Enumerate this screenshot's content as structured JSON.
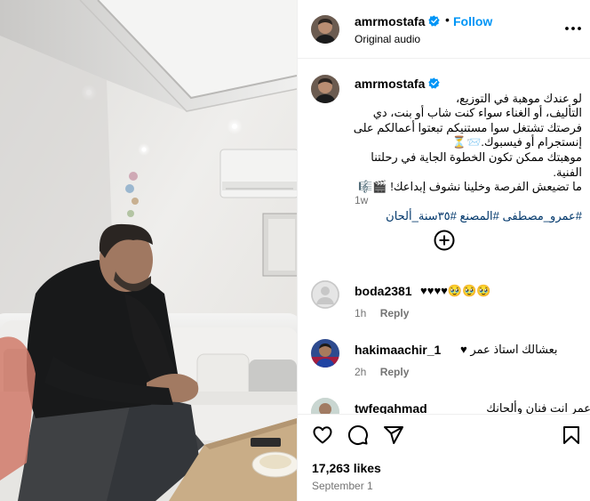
{
  "header": {
    "username": "amrmostafa",
    "separator": "•",
    "follow_label": "Follow",
    "audio": "Original audio"
  },
  "caption": {
    "username": "amrmostafa",
    "text": "لو عندك موهبة في التوزيع،\nالتأليف، أو الغناء سواء كنت شاب أو بنت، دي\nفرصتك تشتغل سوا مستنيكم تبعتوا أعمالكم على\nإنستجرام أو فيسبوك.📨⏳\nموهبتك ممكن تكون الخطوة الجاية في رحلتنا الفنية.\nما تضيعش الفرصة وخلينا نشوف إبداعك! 🎬🎼",
    "hashtags": "#عمرو_مصطفى #المصنع #٣٥سنة_ألحان",
    "time": "1w"
  },
  "comments": [
    {
      "username": "boda2381",
      "text": "♥♥♥♥🥹🥹🥹",
      "time": "1h",
      "reply": "Reply"
    },
    {
      "username": "hakimaachir_1",
      "text": "بعشالك استاذ عمر ♥",
      "time": "2h",
      "reply": "Reply"
    },
    {
      "username": "twfeqahmad",
      "text": "عمر انت فنان وألحانك وكلماتك",
      "time": "",
      "reply": ""
    }
  ],
  "post_stats": {
    "likes": "17,263 likes",
    "date": "September 1"
  },
  "icons": {
    "verified": "verified-badge-icon",
    "more": "more-options-icon",
    "add_comment": "add-comment-icon",
    "like": "heart-icon",
    "comment": "comment-icon",
    "share": "share-icon",
    "save": "bookmark-icon"
  },
  "colors": {
    "accent": "#0095f6",
    "hashtag": "#00376b",
    "muted": "#737373"
  }
}
